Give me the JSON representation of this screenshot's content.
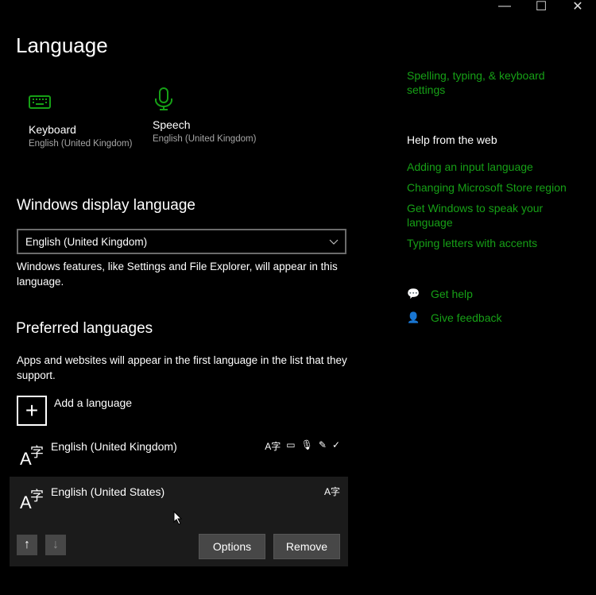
{
  "window": {
    "caption_buttons": [
      {
        "name": "minimize",
        "glyph": "—"
      },
      {
        "name": "maximize",
        "glyph": "☐"
      },
      {
        "name": "close",
        "glyph": "✕"
      }
    ]
  },
  "page": {
    "title": "Language"
  },
  "quick_links": [
    {
      "icon": "keyboard-icon",
      "label": "Keyboard",
      "sub": "English (United Kingdom)"
    },
    {
      "icon": "microphone-icon",
      "label": "Speech",
      "sub": "English (United Kingdom)"
    }
  ],
  "display_language": {
    "heading": "Windows display language",
    "selected": "English (United Kingdom)",
    "description": "Windows features, like Settings and File Explorer, will appear in this language."
  },
  "preferred": {
    "heading": "Preferred languages",
    "description": "Apps and websites will appear in the first language in the list that they support.",
    "add_label": "Add a language",
    "languages": [
      {
        "name": "English (United Kingdom)",
        "features": [
          "language-pack-icon",
          "display-language-icon",
          "speech-icon",
          "handwriting-icon",
          "spelling-icon"
        ]
      },
      {
        "name": "English (United States)",
        "features": [
          "language-pack-icon"
        ]
      }
    ],
    "options_label": "Options",
    "remove_label": "Remove"
  },
  "sidebar": {
    "related_link": "Spelling, typing, & keyboard settings",
    "help_heading": "Help from the web",
    "help_links": [
      "Adding an input language",
      "Changing Microsoft Store region",
      "Get Windows to speak your language",
      "Typing letters with accents"
    ],
    "get_help": "Get help",
    "give_feedback": "Give feedback"
  },
  "colors": {
    "accent": "#16a016",
    "background": "#000000",
    "selected_row": "#1b1b1b",
    "button": "#474747"
  }
}
